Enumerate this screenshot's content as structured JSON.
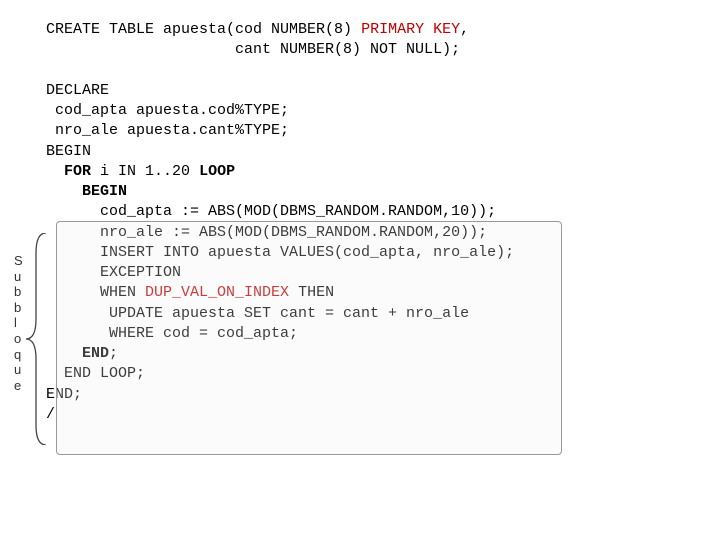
{
  "create": {
    "l1a": "CREATE TABLE apuesta(cod NUMBER(8) ",
    "l1b": "PRIMARY KEY",
    "l1c": ",",
    "l2": "                     cant NUMBER(8) NOT NULL);"
  },
  "block": {
    "l1": "DECLARE",
    "l2": " cod_apta apuesta.cod%TYPE;",
    "l3": " nro_ale apuesta.cant%TYPE;",
    "l4": "BEGIN",
    "l5a": "  ",
    "l5b": "FOR",
    "l5c": " i IN 1..20 ",
    "l5d": "LOOP",
    "l6a": "    ",
    "l6b": "BEGIN",
    "l7": "      cod_apta := ABS(MOD(DBMS_RANDOM.RANDOM,10));",
    "l8": "      nro_ale := ABS(MOD(DBMS_RANDOM.RANDOM,20));",
    "l9": "      INSERT INTO apuesta VALUES(cod_apta, nro_ale);",
    "l10": "      EXCEPTION",
    "l11a": "      WHEN ",
    "l11b": "DUP_VAL_ON_INDEX",
    "l11c": " THEN",
    "l12": "       UPDATE apuesta SET cant = cant + nro_ale",
    "l13": "       WHERE cod = cod_apta;",
    "l14a": "    ",
    "l14b": "END",
    "l14c": ";",
    "l15": "  END LOOP;",
    "l16": "END;",
    "l17": "/"
  },
  "label": {
    "c1": "S",
    "c2": "u",
    "c3": "b",
    "c4": "b",
    "c5": "l",
    "c6": "o",
    "c7": "q",
    "c8": "u",
    "c9": "e"
  }
}
